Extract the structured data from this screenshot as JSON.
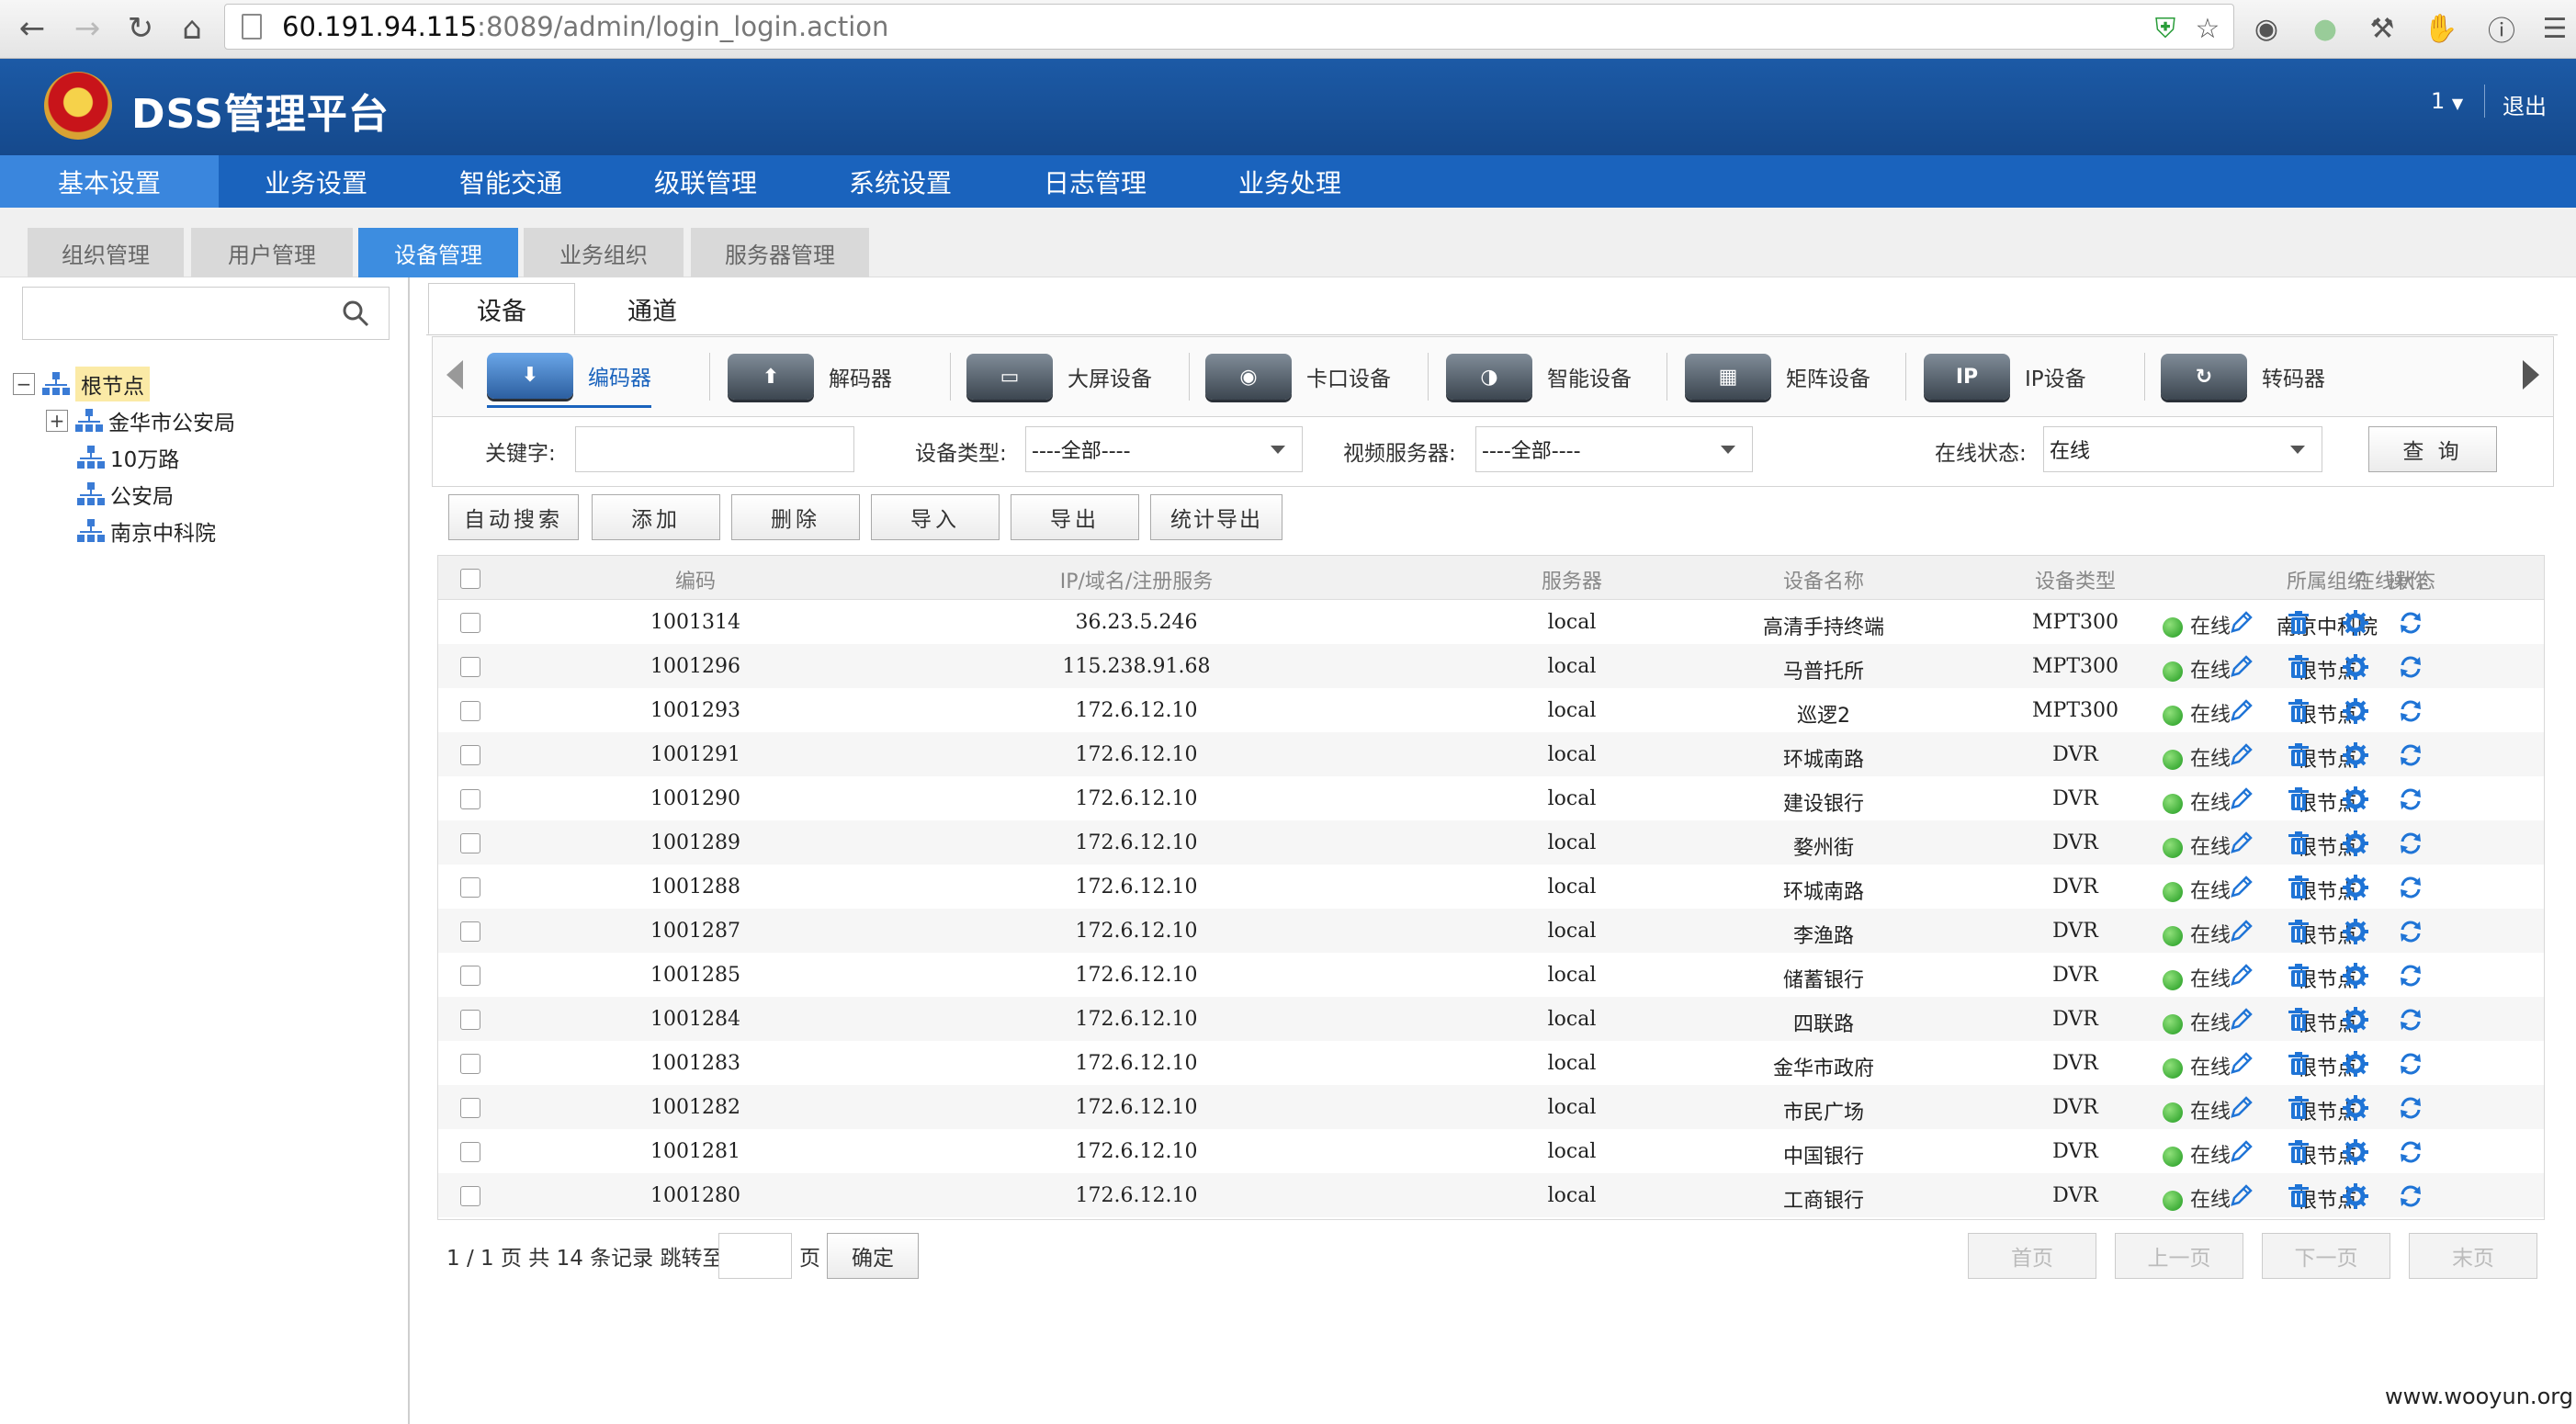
{
  "browser": {
    "url_host": "60.191.94.115",
    "url_rest": ":8089/admin/login_login.action"
  },
  "header": {
    "title": "DSS管理平台",
    "user": "1",
    "logout": "退出"
  },
  "main_nav": [
    "基本设置",
    "业务设置",
    "智能交通",
    "级联管理",
    "系统设置",
    "日志管理",
    "业务处理"
  ],
  "main_nav_active": 0,
  "sub_nav": [
    "组织管理",
    "用户管理",
    "设备管理",
    "业务组织",
    "服务器管理"
  ],
  "sub_nav_active": 2,
  "tree": {
    "root": "根节点",
    "children": [
      "金华市公安局",
      "10万路",
      "公安局",
      "南京中科院"
    ]
  },
  "content_tabs": [
    "设备",
    "通道"
  ],
  "device_types": [
    {
      "label": "编码器",
      "icon": "encoder-icon"
    },
    {
      "label": "解码器",
      "icon": "decoder-icon"
    },
    {
      "label": "大屏设备",
      "icon": "screen-icon"
    },
    {
      "label": "卡口设备",
      "icon": "checkpoint-camera-icon"
    },
    {
      "label": "智能设备",
      "icon": "smart-device-icon"
    },
    {
      "label": "矩阵设备",
      "icon": "matrix-icon"
    },
    {
      "label": "IP设备",
      "icon": "ip-device-icon",
      "box_text": "IP"
    },
    {
      "label": "转码器",
      "icon": "transcoder-icon"
    }
  ],
  "filters": {
    "keyword_label": "关键字:",
    "keyword_value": "",
    "type_label": "设备类型:",
    "type_value": "----全部----",
    "server_label": "视频服务器:",
    "server_value": "----全部----",
    "status_label": "在线状态:",
    "status_value": "在线",
    "query": "查 询"
  },
  "actions": [
    "自动搜索",
    "添加",
    "删除",
    "导入",
    "导出",
    "统计导出"
  ],
  "table": {
    "headers": [
      "编码",
      "IP/域名/注册服务",
      "服务器",
      "设备名称",
      "设备类型",
      "所属组织",
      "在线状态",
      "操作"
    ],
    "rows": [
      [
        "1001314",
        "36.23.5.246",
        "local",
        "高清手持终端",
        "MPT300",
        "南京中科院",
        "在线"
      ],
      [
        "1001296",
        "115.238.91.68",
        "local",
        "马普托所",
        "MPT300",
        "根节点",
        "在线"
      ],
      [
        "1001293",
        "172.6.12.10",
        "local",
        "巡逻2",
        "MPT300",
        "根节点",
        "在线"
      ],
      [
        "1001291",
        "172.6.12.10",
        "local",
        "环城南路",
        "DVR",
        "根节点",
        "在线"
      ],
      [
        "1001290",
        "172.6.12.10",
        "local",
        "建设银行",
        "DVR",
        "根节点",
        "在线"
      ],
      [
        "1001289",
        "172.6.12.10",
        "local",
        "婺州街",
        "DVR",
        "根节点",
        "在线"
      ],
      [
        "1001288",
        "172.6.12.10",
        "local",
        "环城南路",
        "DVR",
        "根节点",
        "在线"
      ],
      [
        "1001287",
        "172.6.12.10",
        "local",
        "李渔路",
        "DVR",
        "根节点",
        "在线"
      ],
      [
        "1001285",
        "172.6.12.10",
        "local",
        "储蓄银行",
        "DVR",
        "根节点",
        "在线"
      ],
      [
        "1001284",
        "172.6.12.10",
        "local",
        "四联路",
        "DVR",
        "根节点",
        "在线"
      ],
      [
        "1001283",
        "172.6.12.10",
        "local",
        "金华市政府",
        "DVR",
        "根节点",
        "在线"
      ],
      [
        "1001282",
        "172.6.12.10",
        "local",
        "市民广场",
        "DVR",
        "根节点",
        "在线"
      ],
      [
        "1001281",
        "172.6.12.10",
        "local",
        "中国银行",
        "DVR",
        "根节点",
        "在线"
      ],
      [
        "1001280",
        "172.6.12.10",
        "local",
        "工商银行",
        "DVR",
        "根节点",
        "在线"
      ]
    ]
  },
  "pager": {
    "summary": "1 / 1 页 共 14 条记录 跳转至",
    "page_unit": "页",
    "confirm": "确定",
    "first": "首页",
    "prev": "上一页",
    "next": "下一页",
    "last": "末页"
  },
  "watermark": "www.wooyun.org",
  "colors": {
    "header": "#15498c",
    "nav": "#1a63bd",
    "active_tab": "#3d8de0",
    "online": "#2aa52a",
    "action_icon": "#1f74d6"
  }
}
